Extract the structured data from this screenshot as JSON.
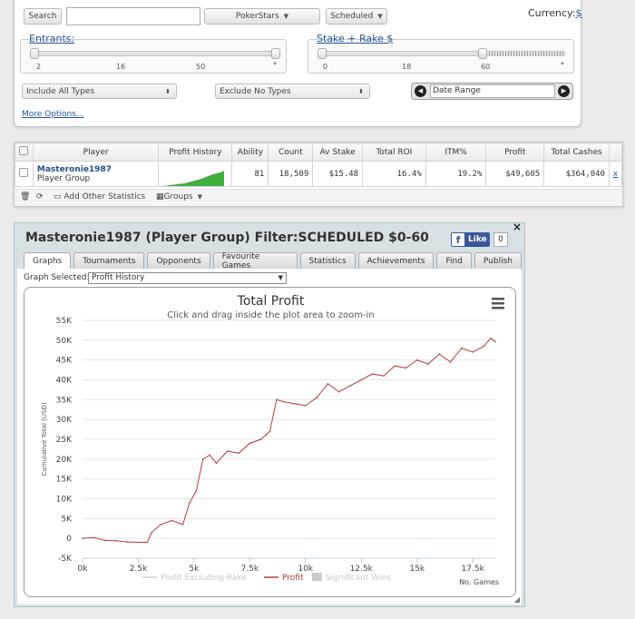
{
  "filters": {
    "search_label": "Search",
    "search_value": "",
    "site": "PokerStars",
    "schedule": "Scheduled",
    "currency_label": "Currency:",
    "currency_value": "$",
    "entrants_label": "Entrants:",
    "entrants_ticks": [
      "2",
      "16",
      "50",
      "*"
    ],
    "stake_label": "Stake + Rake",
    "stake_unit": "$",
    "stake_ticks": [
      "0",
      "18",
      "60",
      "*"
    ],
    "include_types": "Include All Types",
    "exclude_types": "Exclude No Types",
    "date_range": "Date Range",
    "more_options": "More Options..."
  },
  "table": {
    "headers": [
      "Player",
      "Profit History",
      "Ability",
      "Count",
      "Av Stake",
      "Total ROI",
      "ITM%",
      "Profit",
      "Total Cashes"
    ],
    "row": {
      "player_name": "Masteronie1987",
      "player_sub": "Player Group",
      "ability": "81",
      "count": "18,509",
      "av_stake": "$15.48",
      "total_roi": "16.4%",
      "itm": "19.2%",
      "profit": "$49,605",
      "total_cashes": "$364,040",
      "remove": "x"
    },
    "toolbar": {
      "add_stats": "Add Other Statistics",
      "groups": "Groups"
    }
  },
  "graph_panel": {
    "title": "Masteronie1987 (Player Group) Filter:SCHEDULED $0-60",
    "like_label": "Like",
    "like_count": "0",
    "close": "×",
    "tabs": [
      "Graphs",
      "Tournaments",
      "Opponents",
      "Favourite Games",
      "Statistics",
      "Achievements",
      "Find",
      "Publish"
    ],
    "active_tab": "Graphs",
    "graph_selected_label": "Graph Selected:",
    "graph_selected_value": "Profit History"
  },
  "colors": {
    "profit_line": "#b23a3a",
    "excl_rake_line": "#cccccc",
    "sig_wins": "#cccccc",
    "sparkline": "#3fae3f",
    "link": "#225599"
  },
  "chart_data": {
    "type": "line",
    "title": "Total Profit",
    "subtitle": "Click and drag inside the plot area to zoom-in",
    "xlabel": "No. Games",
    "ylabel": "Cumulative Total (USD)",
    "xlim": [
      0,
      18509
    ],
    "ylim": [
      -5000,
      55000
    ],
    "x_ticks": [
      "0k",
      "2.5k",
      "5k",
      "7.5k",
      "10k",
      "12.5k",
      "15k",
      "17.5k"
    ],
    "y_ticks": [
      "-5K",
      "0",
      "5K",
      "10K",
      "15K",
      "20K",
      "25K",
      "30K",
      "35K",
      "40K",
      "45K",
      "50K",
      "55K"
    ],
    "legend": [
      "Profit Excluding Rake",
      "Profit",
      "Significant Wins"
    ],
    "series": [
      {
        "name": "Profit",
        "x": [
          0,
          500,
          1000,
          1500,
          2000,
          2500,
          2900,
          3100,
          3500,
          4000,
          4500,
          4800,
          5100,
          5400,
          5700,
          6000,
          6500,
          7000,
          7500,
          8000,
          8400,
          8700,
          9000,
          9500,
          10000,
          10500,
          11000,
          11500,
          12000,
          12500,
          13000,
          13500,
          14000,
          14500,
          15000,
          15500,
          16000,
          16500,
          17000,
          17500,
          18000,
          18300,
          18509
        ],
        "y": [
          0,
          200,
          -500,
          -600,
          -900,
          -1000,
          -1000,
          1500,
          3500,
          4500,
          3500,
          9000,
          12000,
          20000,
          21000,
          19000,
          22000,
          21500,
          24000,
          25000,
          27000,
          35000,
          34500,
          34000,
          33500,
          35500,
          39000,
          37000,
          38500,
          40000,
          41500,
          41000,
          43500,
          43000,
          45000,
          44000,
          46500,
          44500,
          48000,
          47000,
          48500,
          50500,
          49605
        ]
      }
    ]
  }
}
